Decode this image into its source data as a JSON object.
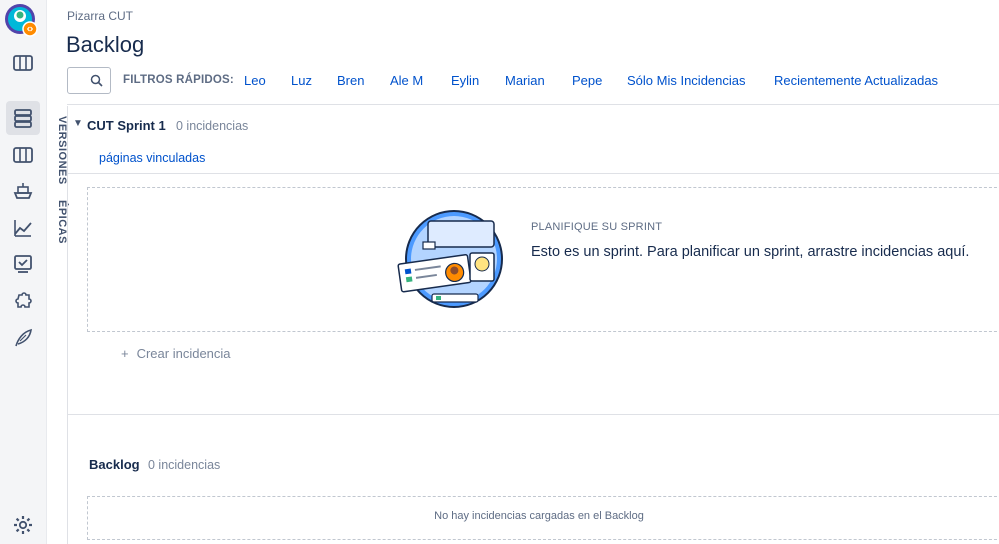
{
  "nav": {
    "icons": [
      "app-avatar-icon",
      "board-icon",
      "backlog-icon",
      "columns-icon",
      "releases-icon",
      "reports-icon",
      "issues-icon",
      "addons-icon",
      "feather-icon",
      "settings-icon"
    ]
  },
  "side_tabs": {
    "versions": "VERSIONES",
    "epics": "ÉPICAS"
  },
  "header": {
    "breadcrumb": "Pizarra CUT",
    "title": "Backlog"
  },
  "filters": {
    "label": "FILTROS RÁPIDOS:",
    "items": [
      "Leo",
      "Luz",
      "Bren",
      "Ale M",
      "Eylin",
      "Marian",
      "Pepe",
      "Sólo Mis Incidencias",
      "Recientemente Actualizadas"
    ]
  },
  "sprint": {
    "name": "CUT Sprint 1",
    "count": "0 incidencias",
    "linked_pages": "páginas vinculadas",
    "empty_heading": "PLANIFIQUE SU SPRINT",
    "empty_text": "Esto es un sprint. Para planificar un sprint, arrastre incidencias aquí.",
    "create_issue": "Crear incidencia",
    "create_issue_icon": "+"
  },
  "backlog": {
    "name": "Backlog",
    "count": "0 incidencias",
    "empty_text": "No hay incidencias cargadas en el Backlog"
  },
  "colors": {
    "link": "#0052cc",
    "text": "#172b4d",
    "muted": "#7a869a",
    "nav_bg": "#f4f5f7"
  }
}
